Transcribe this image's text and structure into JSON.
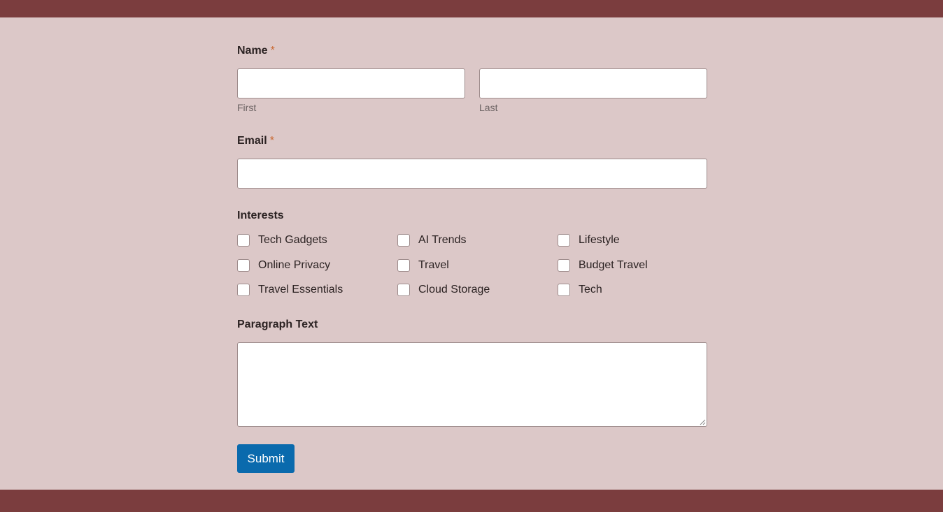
{
  "colors": {
    "bar": "#7b3d3e",
    "background": "#dcc8c8",
    "required": "#c8652c",
    "submit": "#0a6aad"
  },
  "name_field": {
    "label": "Name",
    "required_marker": "*",
    "first": {
      "value": "",
      "sublabel": "First"
    },
    "last": {
      "value": "",
      "sublabel": "Last"
    }
  },
  "email_field": {
    "label": "Email",
    "required_marker": "*",
    "value": ""
  },
  "interests": {
    "label": "Interests",
    "options": [
      {
        "label": "Tech Gadgets",
        "checked": false
      },
      {
        "label": "AI Trends",
        "checked": false
      },
      {
        "label": "Lifestyle",
        "checked": false
      },
      {
        "label": "Online Privacy",
        "checked": false
      },
      {
        "label": "Travel",
        "checked": false
      },
      {
        "label": "Budget Travel",
        "checked": false
      },
      {
        "label": "Travel Essentials",
        "checked": false
      },
      {
        "label": "Cloud Storage",
        "checked": false
      },
      {
        "label": "Tech",
        "checked": false
      }
    ]
  },
  "paragraph": {
    "label": "Paragraph Text",
    "value": ""
  },
  "submit_label": "Submit"
}
